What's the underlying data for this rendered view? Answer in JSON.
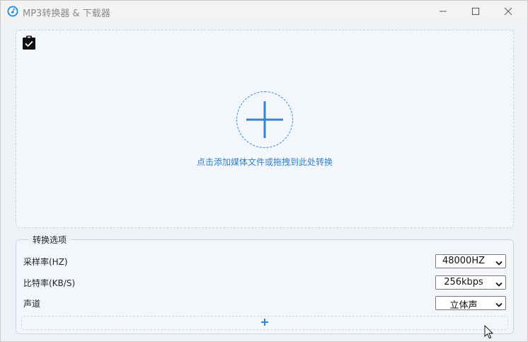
{
  "window": {
    "title": "MP3转换器 & 下载器"
  },
  "icons": {
    "app": "music-note-icon",
    "clipboard": "clipboard-check-icon",
    "add": "plus-icon",
    "minimize": "minimize-icon",
    "maximize": "maximize-icon",
    "close": "close-icon",
    "chevron": "chevron-down-icon"
  },
  "dropzone": {
    "hint": "点击添加媒体文件或拖拽到此处转换"
  },
  "options": {
    "legend": "转换选项",
    "sample_rate": {
      "label": "采样率(HZ)",
      "value": "48000HZ"
    },
    "bitrate": {
      "label": "比特率(KB/S)",
      "value": "256kbps"
    },
    "channel": {
      "label": "声道",
      "value": "立体声"
    }
  },
  "colors": {
    "accent": "#2e86d4",
    "hint_text": "#2f7fc8",
    "dropzone_border": "#c5d3e3",
    "background": "#eef2f7"
  }
}
